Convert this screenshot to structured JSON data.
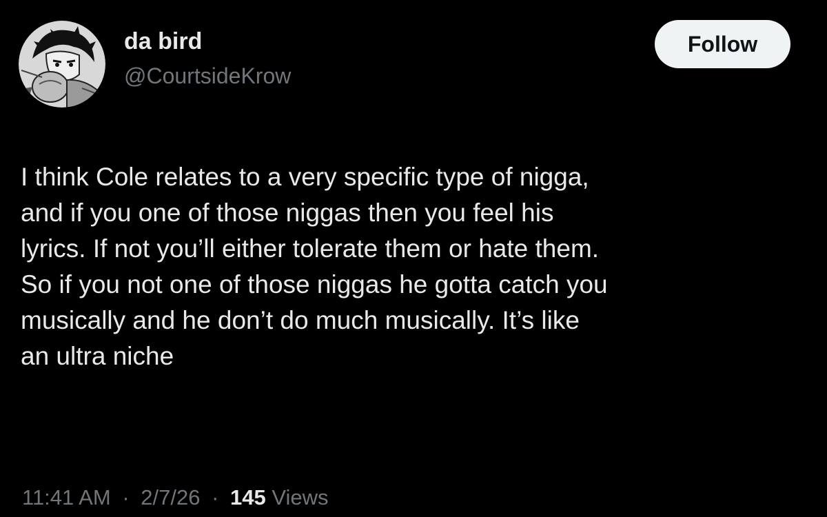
{
  "author": {
    "display_name": "da bird",
    "handle": "@CourtsideKrow",
    "avatar_icon": "manga-boxer-avatar"
  },
  "follow_button": {
    "label": "Follow"
  },
  "tweet": {
    "lines": [
      "I think Cole relates to a very specific type of nigga,",
      "and if you one of those niggas then you feel his",
      "lyrics. If not you’ll either tolerate them or hate them.",
      "So if you not one of those niggas he gotta catch you",
      "musically and he don’t do much musically. It’s like",
      "an ultra niche"
    ]
  },
  "meta": {
    "time": "11:41 AM",
    "separator": "·",
    "date": "2/7/26",
    "views_count": "145",
    "views_label": "Views"
  },
  "colors": {
    "background": "#000000",
    "primary_text": "#e7e9ea",
    "secondary_text": "#71767b",
    "follow_bg": "#eff3f4",
    "follow_text": "#0f1419"
  }
}
